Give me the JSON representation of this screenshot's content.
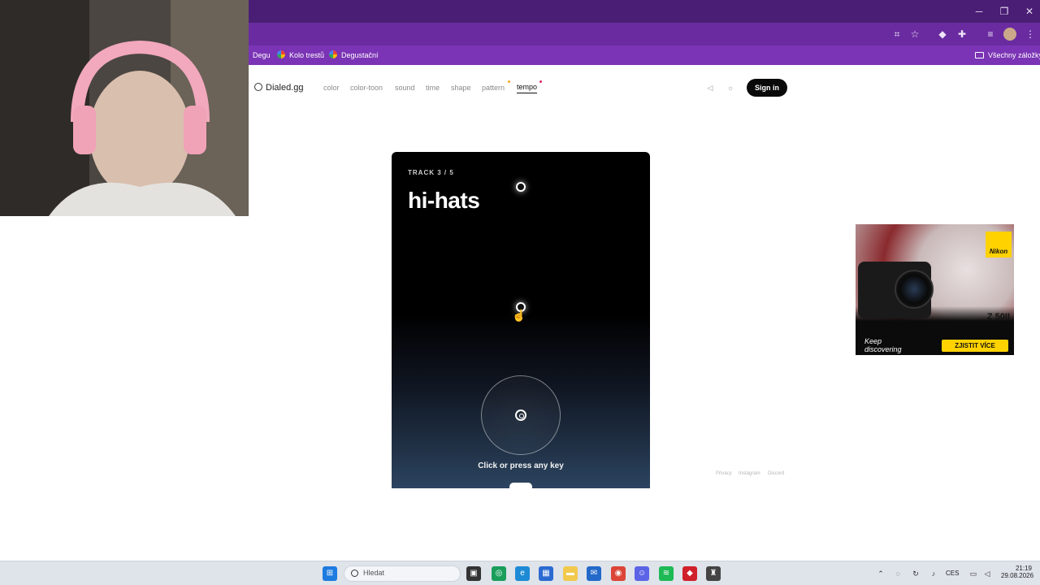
{
  "browser": {
    "window_controls": [
      "─",
      "❐",
      "✕"
    ],
    "bookmarks": [
      {
        "label": "Degu"
      },
      {
        "label": "Kolo trestů"
      },
      {
        "label": "Degustační"
      }
    ],
    "all_bookmarks_label": "Všechny záložky"
  },
  "site": {
    "logo": "Dialed.gg",
    "nav": [
      "color",
      "color-toon",
      "sound",
      "time",
      "shape",
      "pattern",
      "tempo"
    ],
    "active_nav": "tempo",
    "sign_in": "Sign in"
  },
  "game": {
    "track_label": "TRACK 3 / 5",
    "track_name": "hi-hats",
    "hint": "Click or press any key"
  },
  "ad": {
    "brand": "Nikon",
    "model": "Z 50II",
    "tagline_line1": "Keep",
    "tagline_line2": "discovering",
    "cta": "ZJISTIT VÍCE"
  },
  "footer": [
    "Privacy",
    "Instagram",
    "Discord"
  ],
  "taskbar": {
    "search_placeholder": "Hledat",
    "language": "CES",
    "time": "21:19",
    "date": "29.08.2026"
  },
  "colors": {
    "titlebar": "#4a1e74",
    "toolbar": "#6a2ba0",
    "bookmarks_bar": "#7b34b5",
    "accent_dot_orange": "#f5a623",
    "accent_dot_red": "#e0245e"
  }
}
